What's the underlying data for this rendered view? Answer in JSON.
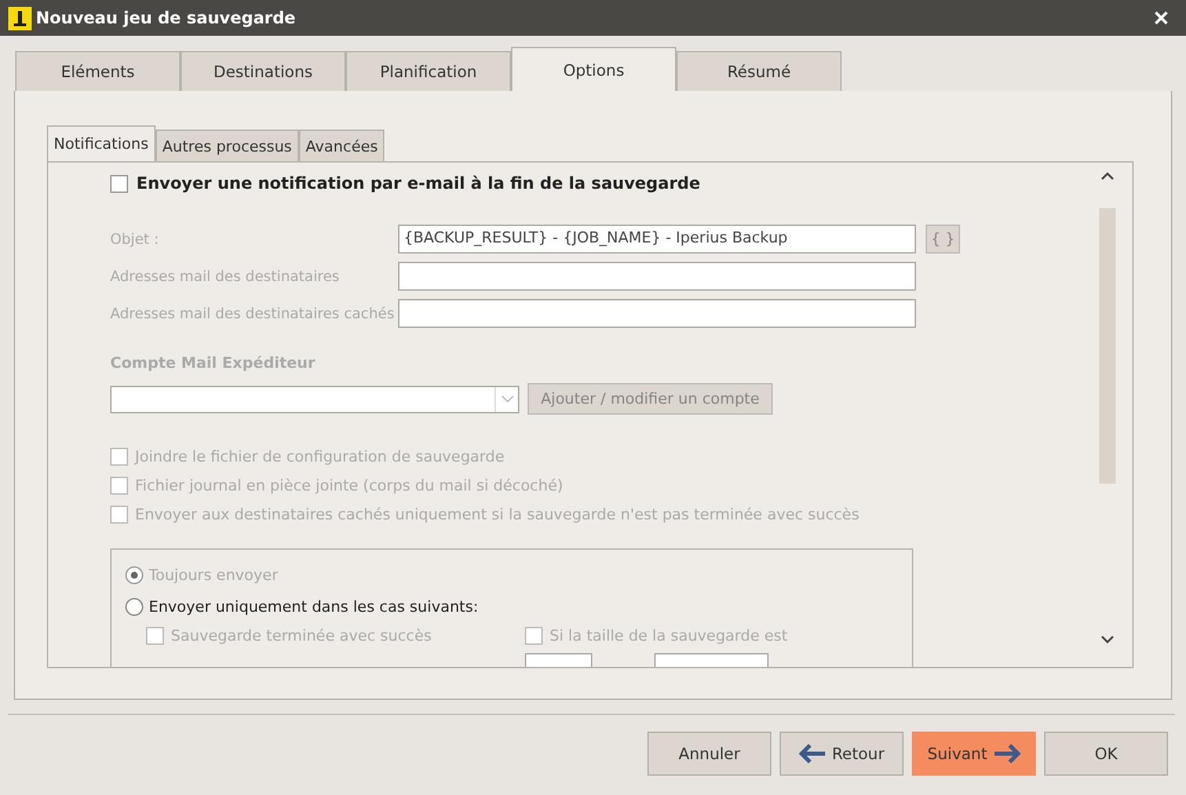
{
  "window": {
    "title": "Nouveau jeu de sauvegarde"
  },
  "tabs": [
    {
      "label": "Eléments",
      "selected": false
    },
    {
      "label": "Destinations",
      "selected": false
    },
    {
      "label": "Planification",
      "selected": false
    },
    {
      "label": "Options",
      "selected": true
    },
    {
      "label": "Résumé",
      "selected": false
    }
  ],
  "subtabs": [
    {
      "label": "Notifications",
      "selected": true
    },
    {
      "label": "Autres processus",
      "selected": false
    },
    {
      "label": "Avancées",
      "selected": false
    }
  ],
  "notifications": {
    "send_email": {
      "label": "Envoyer une notification par e-mail à la fin de la sauvegarde",
      "checked": false
    },
    "fields": [
      {
        "label": "Objet :",
        "value": "{BACKUP_RESULT} - {JOB_NAME} - Iperius Backup",
        "variables_button": "{ }"
      },
      {
        "label": "Adresses mail des destinataires"
      },
      {
        "label": "Adresses mail des destinataires cachés"
      }
    ],
    "sender_heading": "Compte Mail Expéditeur",
    "add_account_button": "Ajouter / modifier un compte",
    "options": [
      {
        "label": "Joindre le fichier de configuration de sauvegarde",
        "checked": false,
        "disabled": true
      },
      {
        "label": "Fichier journal en pièce jointe (corps du mail si décoché)",
        "checked": false,
        "disabled": true
      },
      {
        "label": "Envoyer aux destinataires cachés uniquement si la sauvegarde n'est pas terminée avec succès",
        "checked": false,
        "disabled": true
      }
    ],
    "radios": [
      {
        "label": "Toujours envoyer",
        "selected": true,
        "disabled": true
      },
      {
        "label": "Envoyer uniquement dans les cas suivants:",
        "selected": false,
        "disabled": false
      }
    ],
    "conditions": [
      {
        "label": "Sauvegarde terminée avec succès",
        "checked": false,
        "disabled": true
      },
      {
        "label": "Si la taille de la sauvegarde est",
        "checked": false,
        "disabled": true
      }
    ]
  },
  "buttons": [
    {
      "label": "Annuler",
      "kind": "plain",
      "highlighted": false
    },
    {
      "label": "Retour",
      "kind": "back",
      "highlighted": false
    },
    {
      "label": "Suivant",
      "kind": "next",
      "highlighted": true
    },
    {
      "label": "OK",
      "kind": "plain",
      "highlighted": false
    }
  ]
}
